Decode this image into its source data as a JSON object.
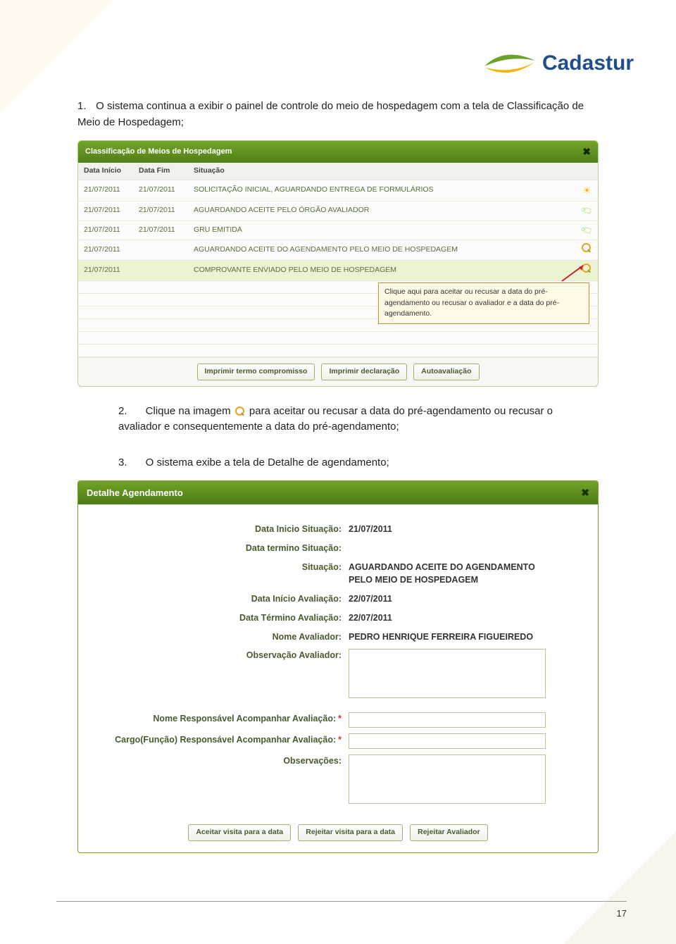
{
  "logo": {
    "text": "Cadastur"
  },
  "step1": {
    "num": "1.",
    "text": "O sistema continua a exibir o painel de controle do meio de hospedagem com a tela de Classificação de Meio de Hospedagem;"
  },
  "panel1": {
    "title": "Classificação de Meios de Hospedagem",
    "headers": {
      "col1": "Data Início",
      "col2": "Data Fim",
      "col3": "Situação"
    },
    "rows": [
      {
        "inicio": "21/07/2011",
        "fim": "21/07/2011",
        "situacao": "SOLICITAÇÃO INICIAL, AGUARDANDO ENTREGA DE FORMULÁRIOS",
        "icon": "sun"
      },
      {
        "inicio": "21/07/2011",
        "fim": "21/07/2011",
        "situacao": "AGUARDANDO ACEITE PELO ÓRGÃO AVALIADOR",
        "icon": "tag"
      },
      {
        "inicio": "21/07/2011",
        "fim": "21/07/2011",
        "situacao": "GRU EMITIDA",
        "icon": "tag"
      },
      {
        "inicio": "21/07/2011",
        "fim": "",
        "situacao": "AGUARDANDO ACEITE DO AGENDAMENTO PELO MEIO DE HOSPEDAGEM",
        "icon": "magnifier"
      },
      {
        "inicio": "21/07/2011",
        "fim": "",
        "situacao": "COMPROVANTE ENVIADO PELO MEIO DE HOSPEDAGEM",
        "icon": "magnifier",
        "highlight": true
      }
    ],
    "callout": "Clique aqui para aceitar ou recusar a data do pré-agendamento ou recusar o avaliador e a data do pré-agendamento.",
    "buttons": {
      "b1": "Imprimir termo compromisso",
      "b2": "Imprimir declaração",
      "b3": "Autoavaliação"
    }
  },
  "step2": {
    "num": "2.",
    "text_before": "Clique na imagem ",
    "text_after": " para aceitar ou recusar a data do pré-agendamento ou recusar o avaliador e consequentemente a data do pré-agendamento;"
  },
  "step3": {
    "num": "3.",
    "text": "O sistema exibe a tela de Detalhe de agendamento;"
  },
  "panel2": {
    "title": "Detalhe Agendamento",
    "fields": {
      "data_inicio_sit": {
        "label": "Data Inicio Situação:",
        "value": "21/07/2011"
      },
      "data_termino_sit": {
        "label": "Data termino Situação:",
        "value": ""
      },
      "situacao": {
        "label": "Situação:",
        "value": "AGUARDANDO ACEITE DO AGENDAMENTO PELO MEIO DE HOSPEDAGEM"
      },
      "data_inicio_aval": {
        "label": "Data Início Avaliação:",
        "value": "22/07/2011"
      },
      "data_termino_aval": {
        "label": "Data Término Avaliação:",
        "value": "22/07/2011"
      },
      "nome_avaliador": {
        "label": "Nome Avaliador:",
        "value": "PEDRO HENRIQUE FERREIRA FIGUEIREDO"
      },
      "obs_avaliador": {
        "label": "Observação Avaliador:"
      },
      "nome_resp": {
        "label": "Nome Responsável Acompanhar Avaliação:",
        "required": true
      },
      "cargo_resp": {
        "label": "Cargo(Função) Responsável Acompanhar Avaliação:",
        "required": true
      },
      "observacoes": {
        "label": "Observações:"
      }
    },
    "buttons": {
      "b1": "Aceitar visita para a data",
      "b2": "Rejeitar visita para a data",
      "b3": "Rejeitar Avaliador"
    }
  },
  "page_number": "17"
}
